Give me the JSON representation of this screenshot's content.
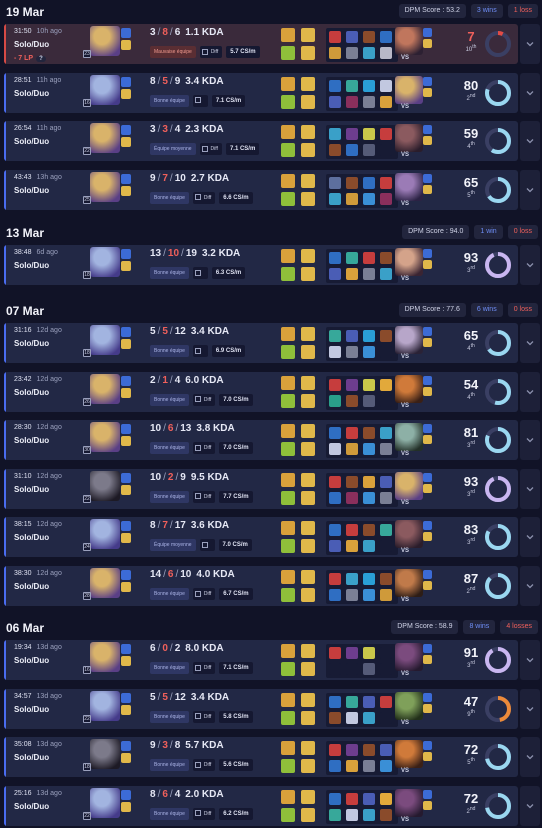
{
  "days": [
    {
      "date": "19 Mar",
      "dpm": "DPM Score : 53.2",
      "wins": "3 wins",
      "losses": "1 loss",
      "games": [
        {
          "result": "loss",
          "time": "31:50",
          "ago": "10h ago",
          "queue": "Solo/Duo",
          "lp": "- 7 LP",
          "lp_help": "?",
          "level": "23",
          "k": "3",
          "d": "8",
          "a": "6",
          "kda": "1.1 KDA",
          "tag": "Mauvaise équipe",
          "tag_bad": true,
          "diff": "Diff",
          "cs": "5.7 CS/m",
          "score": "7",
          "rank": "10",
          "rank_sfx": "th",
          "score_pct": 0.07,
          "score_color": "#e24b45",
          "champ": "#d9b36a",
          "champ2": "#5a3f86",
          "opp": "#c0765d",
          "opp2": "#2c2032",
          "items": [
            "#c63d3d",
            "#4a5db5",
            "#8a4b2b",
            "#2f6ec2",
            "#cf9a3a",
            "#7a7f95",
            "#3aa0c8",
            "#b8b8c8"
          ]
        },
        {
          "result": "win",
          "time": "28:51",
          "ago": "11h ago",
          "queue": "Solo/Duo",
          "level": "16",
          "k": "8",
          "d": "5",
          "a": "9",
          "kda": "3.4 KDA",
          "tag": "Bonne équipe",
          "tag_bad": false,
          "diff": "",
          "cs": "7.1 CS/m",
          "score": "80",
          "rank": "2",
          "rank_sfx": "nd",
          "score_pct": 0.8,
          "score_color": "#9ad7f0",
          "champ": "#a2b4e0",
          "champ2": "#453b8a",
          "opp": "#d9b36a",
          "opp2": "#5a3f86",
          "items": [
            "#2f6ec2",
            "#37a89a",
            "#2a9fd6",
            "#c2c8e0",
            "#4a5db5",
            "#8a2f5c",
            "#7a7f95",
            "#d9a13b"
          ]
        },
        {
          "result": "win",
          "time": "26:54",
          "ago": "11h ago",
          "queue": "Solo/Duo",
          "level": "22",
          "k": "3",
          "d": "3",
          "a": "4",
          "kda": "2.3 KDA",
          "tag": "Équipe moyenne",
          "tag_bad": false,
          "diff": "Diff",
          "cs": "7.1 CS/m",
          "score": "59",
          "rank": "4",
          "rank_sfx": "th",
          "score_pct": 0.59,
          "score_color": "#9ad7f0",
          "champ": "#d9b36a",
          "champ2": "#5a3f86",
          "opp": "#8b5a5f",
          "opp2": "#2a1d2b",
          "items": [
            "#3aa0c8",
            "#6d3d8e",
            "#c9c74a",
            "#c63d3d",
            "#8a4b2b",
            "#2f6ec2",
            "#555b78",
            "#171b34"
          ]
        },
        {
          "result": "win",
          "time": "43:43",
          "ago": "13h ago",
          "queue": "Solo/Duo",
          "level": "25",
          "k": "9",
          "d": "7",
          "a": "10",
          "kda": "2.7 KDA",
          "tag": "Bonne équipe",
          "tag_bad": false,
          "diff": "Diff",
          "cs": "6.6 CS/m",
          "score": "65",
          "rank": "5",
          "rank_sfx": "th",
          "score_pct": 0.65,
          "score_color": "#9ad7f0",
          "champ": "#d9b36a",
          "champ2": "#5a3f86",
          "opp": "#9b7bb6",
          "opp2": "#2b2244",
          "items": [
            "#5d6f9e",
            "#8a4b2b",
            "#2f6ec2",
            "#c63d3d",
            "#3aa0c8",
            "#cf9a3a",
            "#3a8fd6",
            "#8a2f5c"
          ]
        }
      ]
    },
    {
      "date": "13 Mar",
      "dpm": "DPM Score : 94.0",
      "wins": "1 win",
      "losses": "0 loss",
      "games": [
        {
          "result": "win",
          "time": "38:48",
          "ago": "6d ago",
          "queue": "Solo/Duo",
          "level": "18",
          "k": "13",
          "d": "10",
          "a": "19",
          "kda": "3.2 KDA",
          "tag": "Bonne équipe",
          "tag_bad": false,
          "diff": "",
          "cs": "6.3 CS/m",
          "score": "93",
          "rank": "3",
          "rank_sfx": "rd",
          "score_pct": 0.93,
          "score_color": "#c9b6f0",
          "champ": "#a2b4e0",
          "champ2": "#453b8a",
          "opp": "#d4a38a",
          "opp2": "#3a2432",
          "items": [
            "#2f6ec2",
            "#37a89a",
            "#c63d3d",
            "#8a4b2b",
            "#4a5db5",
            "#d9a13b",
            "#7a7f95",
            "#3aa0c8"
          ]
        }
      ]
    },
    {
      "date": "07 Mar",
      "dpm": "DPM Score : 77.6",
      "wins": "6 wins",
      "losses": "0 loss",
      "games": [
        {
          "result": "win",
          "time": "31:16",
          "ago": "12d ago",
          "queue": "Solo/Duo",
          "level": "18",
          "k": "5",
          "d": "5",
          "a": "12",
          "kda": "3.4 KDA",
          "tag": "Bonne équipe",
          "tag_bad": false,
          "diff": "",
          "cs": "6.9 CS/m",
          "score": "65",
          "rank": "4",
          "rank_sfx": "th",
          "score_pct": 0.65,
          "score_color": "#9ad7f0",
          "champ": "#a2b4e0",
          "champ2": "#453b8a",
          "opp": "#b7a6c9",
          "opp2": "#2a2236",
          "items": [
            "#37a89a",
            "#4a5db5",
            "#2a9fd6",
            "#8a4b2b",
            "#c2c8e0",
            "#7a7f95",
            "#3a8fd6",
            "#171b34"
          ]
        },
        {
          "result": "win",
          "time": "23:42",
          "ago": "12d ago",
          "queue": "Solo/Duo",
          "level": "26",
          "k": "2",
          "d": "1",
          "a": "4",
          "kda": "6.0 KDA",
          "tag": "Bonne équipe",
          "tag_bad": false,
          "diff": "Diff",
          "cs": "7.0 CS/m",
          "score": "54",
          "rank": "4",
          "rank_sfx": "th",
          "score_pct": 0.54,
          "score_color": "#9ad7f0",
          "champ": "#d9b36a",
          "champ2": "#5a3f86",
          "opp": "#d07a3a",
          "opp2": "#3a2016",
          "items": [
            "#c63d3d",
            "#6d3d8e",
            "#c9c74a",
            "#e2a93b",
            "#2a9f8a",
            "#8a4b2b",
            "#555b78",
            "#171b34"
          ]
        },
        {
          "result": "win",
          "time": "28:30",
          "ago": "12d ago",
          "queue": "Solo/Duo",
          "level": "30",
          "k": "10",
          "d": "6",
          "a": "13",
          "kda": "3.8 KDA",
          "tag": "Bonne équipe",
          "tag_bad": false,
          "diff": "Diff",
          "cs": "7.0 CS/m",
          "score": "81",
          "rank": "3",
          "rank_sfx": "rd",
          "score_pct": 0.81,
          "score_color": "#9ad7f0",
          "champ": "#d9b36a",
          "champ2": "#5a3f86",
          "opp": "#8db0a6",
          "opp2": "#233028",
          "items": [
            "#2f6ec2",
            "#c63d3d",
            "#8a4b2b",
            "#3aa0c8",
            "#c2c8e0",
            "#cf9a3a",
            "#3a8fd6",
            "#7a7f95"
          ]
        },
        {
          "result": "win",
          "time": "31:10",
          "ago": "12d ago",
          "queue": "Solo/Duo",
          "level": "22",
          "k": "10",
          "d": "2",
          "a": "9",
          "kda": "9.5 KDA",
          "tag": "Bonne équipe",
          "tag_bad": false,
          "diff": "Diff",
          "cs": "7.7 CS/m",
          "score": "93",
          "rank": "3",
          "rank_sfx": "rd",
          "score_pct": 0.93,
          "score_color": "#c9b6f0",
          "champ": "#7c7a8a",
          "champ2": "#1d1a25",
          "opp": "#d9b36a",
          "opp2": "#5a3f86",
          "items": [
            "#c63d3d",
            "#8a4b2b",
            "#d9a13b",
            "#4a5db5",
            "#2f6ec2",
            "#8a2f5c",
            "#3a8fd6",
            "#7a7f95"
          ]
        },
        {
          "result": "win",
          "time": "38:15",
          "ago": "12d ago",
          "queue": "Solo/Duo",
          "level": "24",
          "k": "8",
          "d": "7",
          "a": "17",
          "kda": "3.6 KDA",
          "tag": "Équipe moyenne",
          "tag_bad": false,
          "diff": "",
          "cs": "7.0 CS/m",
          "score": "83",
          "rank": "3",
          "rank_sfx": "rd",
          "score_pct": 0.83,
          "score_color": "#9ad7f0",
          "champ": "#a2b4e0",
          "champ2": "#453b8a",
          "opp": "#8b5a5f",
          "opp2": "#2a1d2b",
          "items": [
            "#2f6ec2",
            "#c63d3d",
            "#8a4b2b",
            "#37a89a",
            "#4a5db5",
            "#d9a13b",
            "#3aa0c8",
            "#171b34"
          ]
        },
        {
          "result": "win",
          "time": "38:30",
          "ago": "12d ago",
          "queue": "Solo/Duo",
          "level": "28",
          "k": "14",
          "d": "6",
          "a": "10",
          "kda": "4.0 KDA",
          "tag": "Bonne équipe",
          "tag_bad": false,
          "diff": "Diff",
          "cs": "6.7 CS/m",
          "score": "87",
          "rank": "2",
          "rank_sfx": "nd",
          "score_pct": 0.87,
          "score_color": "#9ad7f0",
          "champ": "#d9b36a",
          "champ2": "#5a3f86",
          "opp": "#c07a4a",
          "opp2": "#2d1d16",
          "items": [
            "#c63d3d",
            "#3aa0c8",
            "#2a9fd6",
            "#8a4b2b",
            "#2f6ec2",
            "#7a7f95",
            "#3a8fd6",
            "#cf9a3a"
          ]
        }
      ]
    },
    {
      "date": "06 Mar",
      "dpm": "DPM Score : 58.9",
      "wins": "8 wins",
      "losses": "4 losses",
      "games": [
        {
          "result": "win",
          "time": "19:34",
          "ago": "13d ago",
          "queue": "Solo/Duo",
          "level": "16",
          "k": "6",
          "d": "0",
          "a": "2",
          "kda": "8.0 KDA",
          "tag": "Bonne équipe",
          "tag_bad": false,
          "diff": "Diff",
          "cs": "7.1 CS/m",
          "score": "91",
          "rank": "3",
          "rank_sfx": "rd",
          "score_pct": 0.91,
          "score_color": "#c9b6f0",
          "champ": "#d9b36a",
          "champ2": "#5a3f86",
          "opp": "#7b4b7e",
          "opp2": "#251a2f",
          "items": [
            "#c63d3d",
            "#6d3d8e",
            "#c9c74a",
            "#171b34",
            "#171b34",
            "#171b34",
            "#555b78",
            "#171b34"
          ]
        },
        {
          "result": "win",
          "time": "34:57",
          "ago": "13d ago",
          "queue": "Solo/Duo",
          "level": "22",
          "k": "5",
          "d": "5",
          "a": "12",
          "kda": "3.4 KDA",
          "tag": "Bonne équipe",
          "tag_bad": false,
          "diff": "Diff",
          "cs": "5.8 CS/m",
          "score": "47",
          "rank": "9",
          "rank_sfx": "th",
          "score_pct": 0.47,
          "score_color": "#ec8a3a",
          "champ": "#a2b4e0",
          "champ2": "#453b8a",
          "opp": "#7fa05a",
          "opp2": "#22301a",
          "items": [
            "#2f6ec2",
            "#37a89a",
            "#4a5db5",
            "#c63d3d",
            "#8a4b2b",
            "#c2c8e0",
            "#3aa0c8",
            "#171b34"
          ]
        },
        {
          "result": "win",
          "time": "35:08",
          "ago": "13d ago",
          "queue": "Solo/Duo",
          "level": "18",
          "k": "9",
          "d": "3",
          "a": "8",
          "kda": "5.7 KDA",
          "tag": "Bonne équipe",
          "tag_bad": false,
          "diff": "Diff",
          "cs": "5.6 CS/m",
          "score": "72",
          "rank": "5",
          "rank_sfx": "th",
          "score_pct": 0.72,
          "score_color": "#9ad7f0",
          "champ": "#7c7a8a",
          "champ2": "#1d1a25",
          "opp": "#d07a3a",
          "opp2": "#3a2016",
          "items": [
            "#c63d3d",
            "#6d3d8e",
            "#8a4b2b",
            "#4a5db5",
            "#2f6ec2",
            "#d9a13b",
            "#7a7f95",
            "#3a8fd6"
          ]
        },
        {
          "result": "win",
          "time": "25:16",
          "ago": "13d ago",
          "queue": "Solo/Duo",
          "level": "22",
          "k": "8",
          "d": "6",
          "a": "4",
          "kda": "2.0 KDA",
          "tag": "Bonne équipe",
          "tag_bad": false,
          "diff": "Diff",
          "cs": "6.2 CS/m",
          "score": "72",
          "rank": "2",
          "rank_sfx": "nd",
          "score_pct": 0.72,
          "score_color": "#9ad7f0",
          "champ": "#a2b4e0",
          "champ2": "#453b8a",
          "opp": "#7b4b7e",
          "opp2": "#251a2f",
          "items": [
            "#2f6ec2",
            "#c63d3d",
            "#4a5db5",
            "#e2a93b",
            "#37a89a",
            "#c2c8e0",
            "#3aa0c8",
            "#8a4b2b"
          ]
        }
      ]
    }
  ]
}
